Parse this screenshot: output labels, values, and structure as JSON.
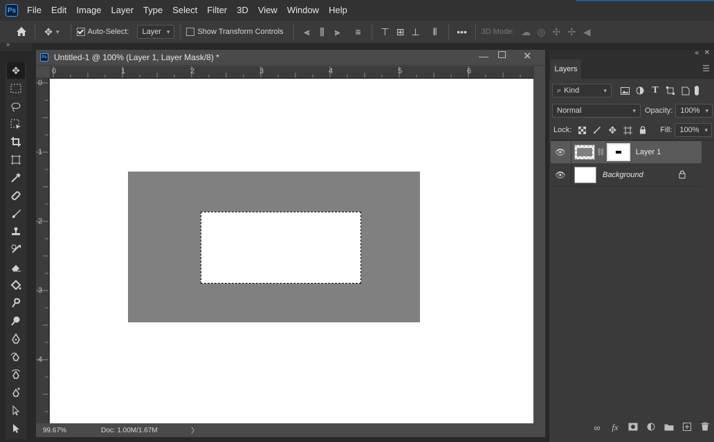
{
  "menubar": {
    "logo": "Ps",
    "items": [
      "File",
      "Edit",
      "Image",
      "Layer",
      "Type",
      "Select",
      "Filter",
      "3D",
      "View",
      "Window",
      "Help"
    ]
  },
  "options": {
    "auto_select_label": "Auto-Select:",
    "auto_select_checked": true,
    "auto_select_target": "Layer",
    "show_transform_label": "Show Transform Controls",
    "show_transform_checked": false,
    "mode_label": "3D Mode:"
  },
  "document": {
    "title": "Untitled-1 @ 100% (Layer 1, Layer Mask/8) *",
    "ruler_top": [
      "0",
      "1",
      "2",
      "3",
      "4",
      "5",
      "6"
    ],
    "ruler_left": [
      "0",
      "1",
      "2",
      "3",
      "4"
    ],
    "zoom": "99.67%",
    "doc_size": "Doc: 1.00M/1.67M"
  },
  "layers_panel": {
    "tab": "Layers",
    "filter": "Kind",
    "blend_mode": "Normal",
    "opacity_label": "Opacity:",
    "opacity": "100%",
    "lock_label": "Lock:",
    "fill_label": "Fill:",
    "fill": "100%",
    "layers": [
      {
        "name": "Layer 1"
      },
      {
        "name": "Background"
      }
    ]
  },
  "colors": {
    "app_bg": "#282828",
    "accent": "#31a8ff",
    "canvas": "#ffffff",
    "shape": "#808080"
  }
}
